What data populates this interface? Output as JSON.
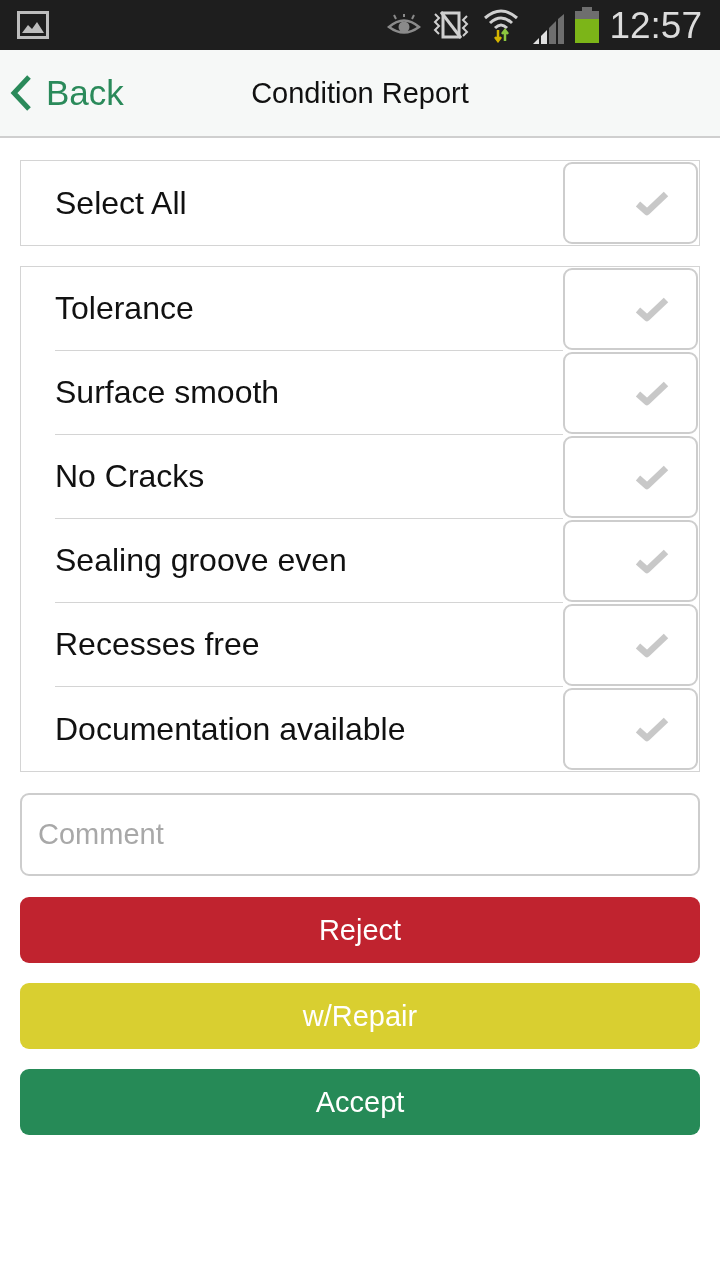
{
  "status_bar": {
    "time": "12:57"
  },
  "nav": {
    "back": "Back",
    "title": "Condition Report"
  },
  "select_all": {
    "label": "Select All",
    "checked": false
  },
  "items": [
    {
      "label": "Tolerance",
      "checked": false
    },
    {
      "label": "Surface smooth",
      "checked": false
    },
    {
      "label": "No Cracks",
      "checked": false
    },
    {
      "label": "Sealing groove even",
      "checked": false
    },
    {
      "label": "Recesses free",
      "checked": false
    },
    {
      "label": "Documentation available",
      "checked": false
    }
  ],
  "comment": {
    "placeholder": "Comment"
  },
  "buttons": [
    {
      "label": "Reject",
      "color": "#c0232f"
    },
    {
      "label": "w/Repair",
      "color": "#d9cf30"
    },
    {
      "label": "Accept",
      "color": "#268a57"
    }
  ]
}
